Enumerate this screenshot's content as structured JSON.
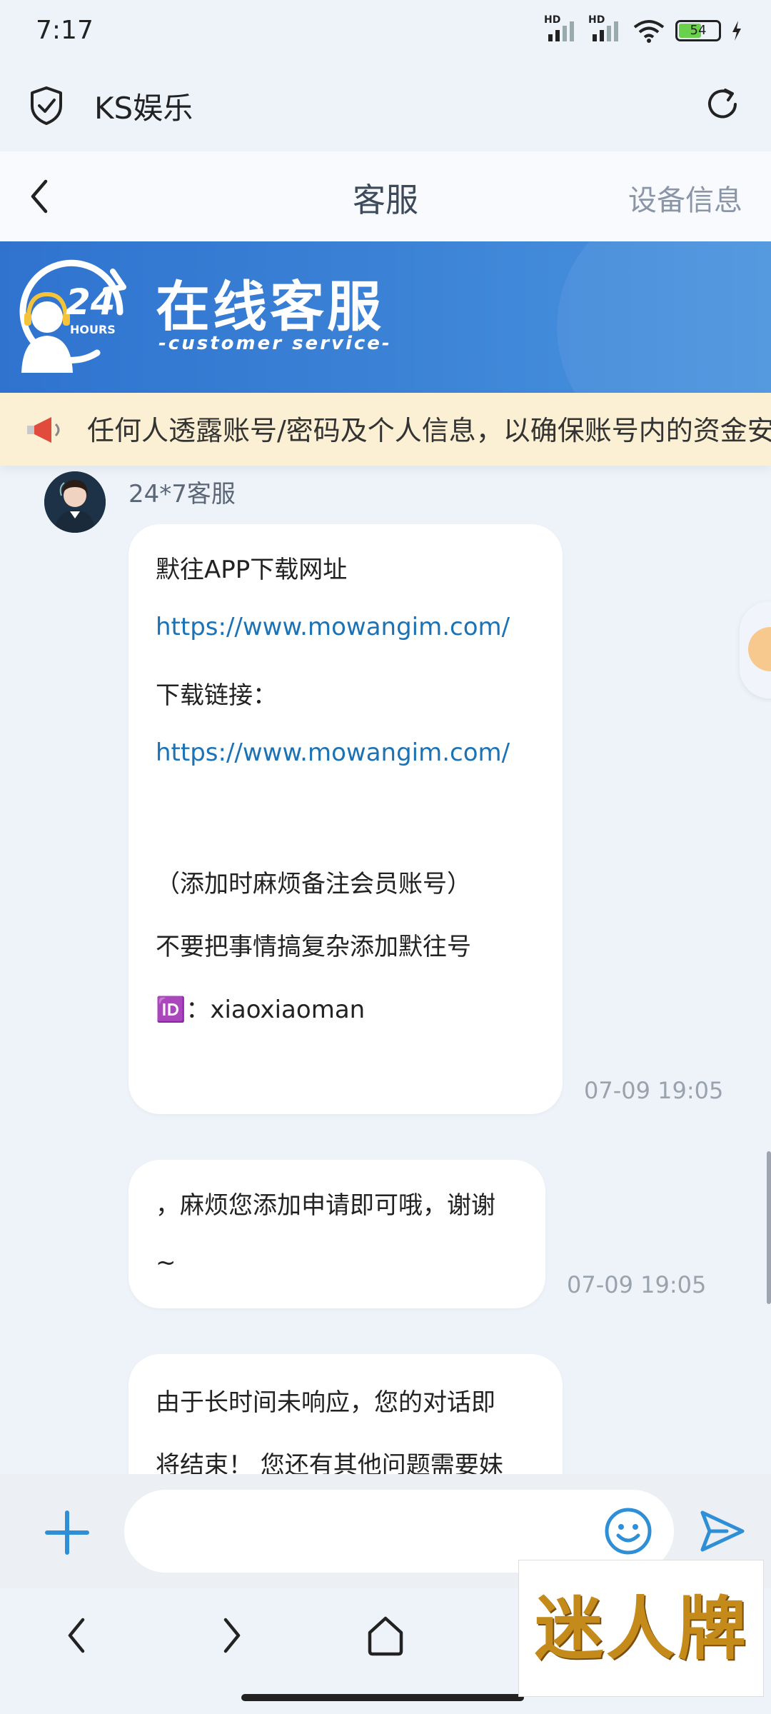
{
  "status": {
    "time": "7:17",
    "battery": "54",
    "network_labels": [
      "HD",
      "HD"
    ]
  },
  "browser": {
    "title": "KS娱乐"
  },
  "header": {
    "title": "客服",
    "right_action": "设备信息"
  },
  "banner": {
    "badge_number": "24",
    "badge_unit": "HOURS",
    "title": "在线客服",
    "subtitle": "-customer service-"
  },
  "notice": {
    "text": "任何人透露账号/密码及个人信息，以确保账号内的资金安"
  },
  "chat": {
    "agent_name": "24*7客服",
    "messages": [
      {
        "lines": [
          {
            "text": "默往APP下载网址",
            "link": false
          },
          {
            "text": "https://www.mowangim.com/",
            "link": true
          },
          {
            "text": "下载链接：",
            "link": false
          },
          {
            "text": "https://www.mowangim.com/",
            "link": true
          },
          {
            "text": "（添加时麻烦备注会员账号）",
            "link": false
          },
          {
            "text": "不要把事情搞复杂添加默往号",
            "link": false
          },
          {
            "text": "🆔：xiaoxiaoman",
            "link": false
          }
        ],
        "time": "07-09 19:05"
      },
      {
        "lines": [
          {
            "text": "，麻烦您添加申请即可哦，谢谢",
            "link": false
          },
          {
            "text": "~",
            "link": false
          }
        ],
        "time": "07-09 19:05"
      },
      {
        "lines": [
          {
            "text": "由于长时间未响应，您的对话即",
            "link": false
          },
          {
            "text": "将结束！ 您还有其他问题需要妹",
            "link": false
          }
        ],
        "time": ""
      }
    ]
  },
  "input": {
    "placeholder": ""
  },
  "watermark": {
    "text": "迷人牌"
  },
  "colors": {
    "accent": "#2f73cf",
    "link": "#1b72b5",
    "notice_bg": "#fbf0d4"
  }
}
